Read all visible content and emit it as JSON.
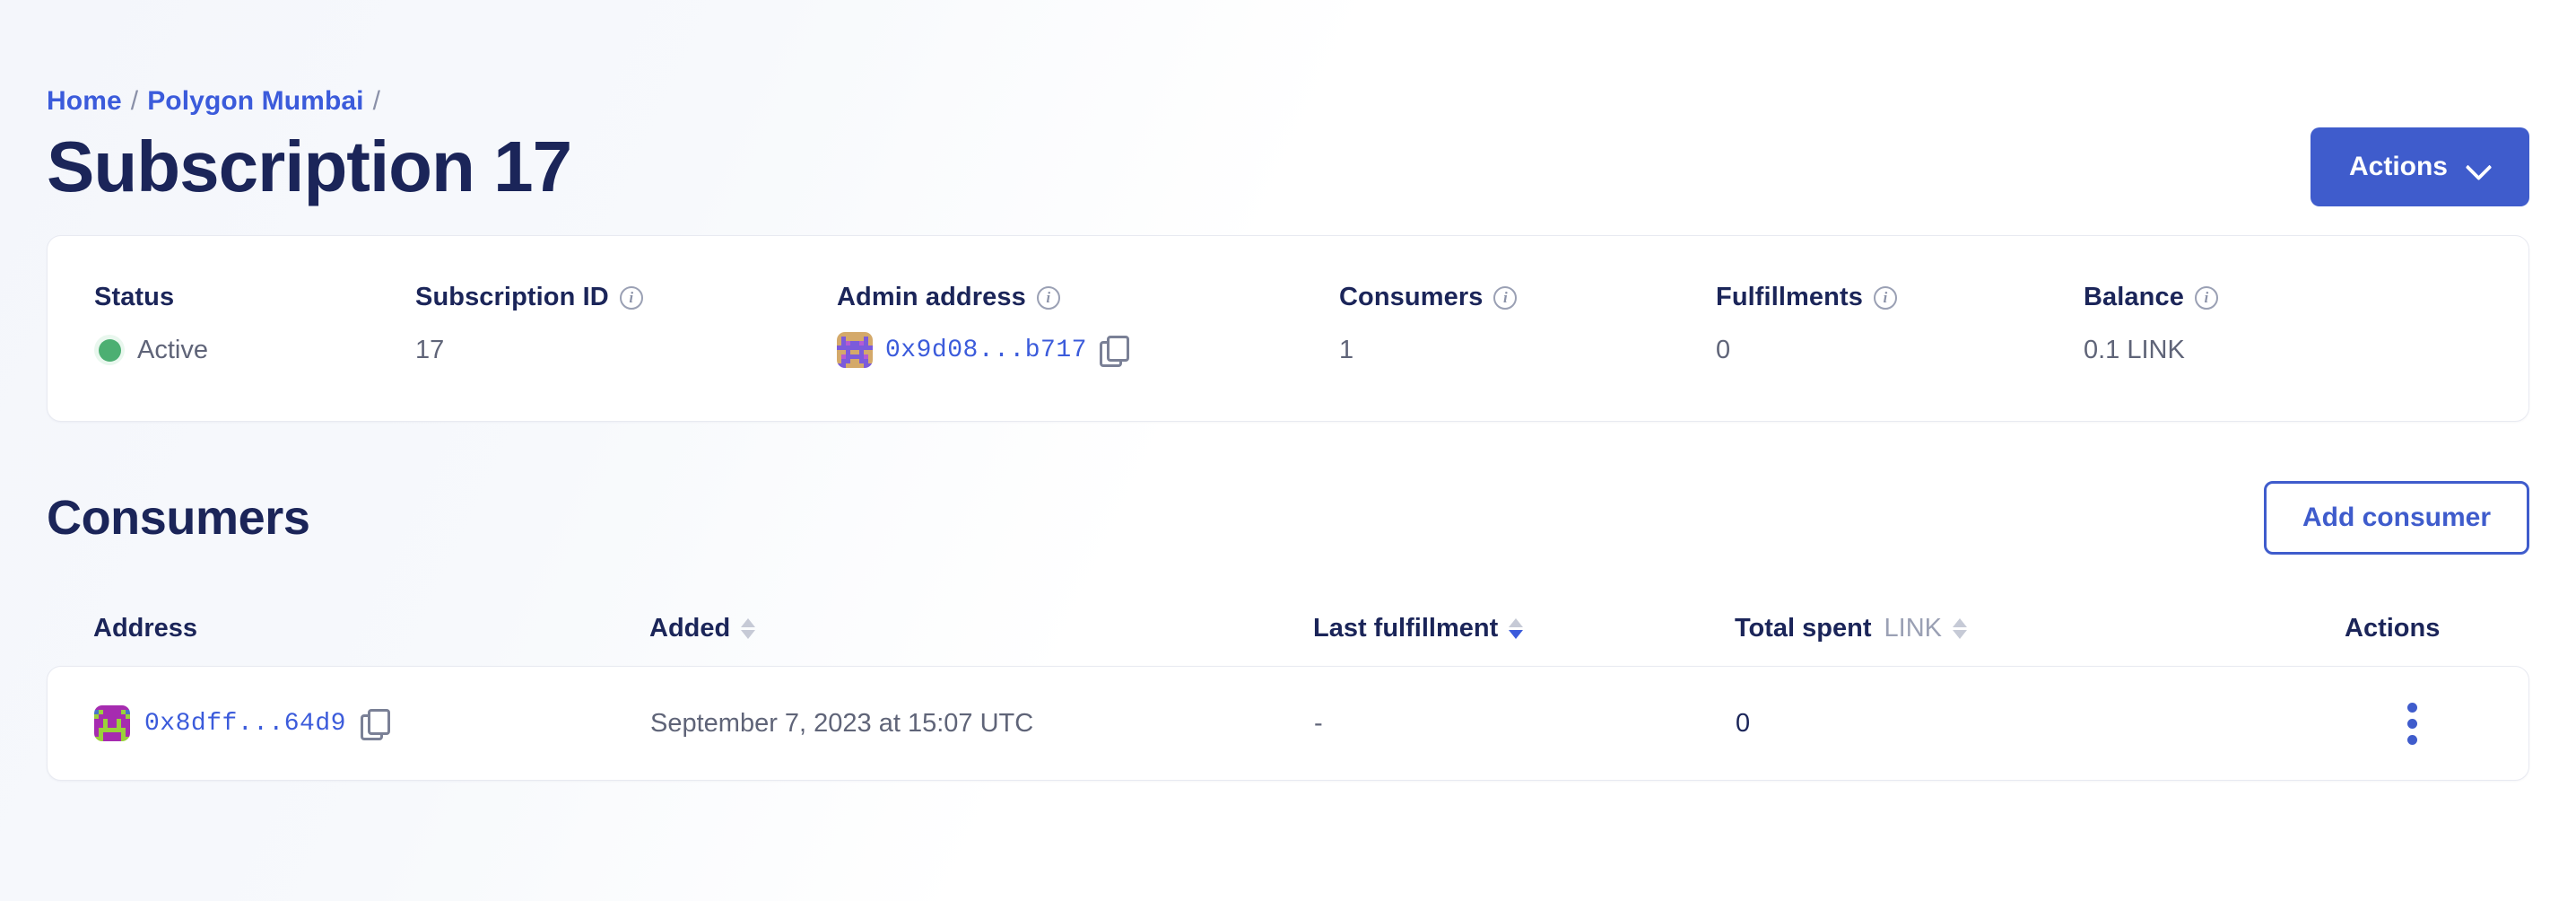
{
  "breadcrumb": {
    "items": [
      {
        "label": "Home",
        "link": true
      },
      {
        "label": "Polygon Mumbai",
        "link": true
      }
    ],
    "separator": "/"
  },
  "header": {
    "title": "Subscription 17",
    "actions_button": "Actions",
    "chevron_icon": "chevron-down-icon"
  },
  "stats": [
    {
      "label": "Status",
      "value": "Active",
      "has_info": false,
      "kind": "status"
    },
    {
      "label": "Subscription ID",
      "value": "17",
      "has_info": true,
      "kind": "text"
    },
    {
      "label": "Admin address",
      "value": "0x9d08...b717",
      "has_info": true,
      "kind": "address"
    },
    {
      "label": "Consumers",
      "value": "1",
      "has_info": true,
      "kind": "text"
    },
    {
      "label": "Fulfillments",
      "value": "0",
      "has_info": true,
      "kind": "text"
    },
    {
      "label": "Balance",
      "value": "0.1 LINK",
      "has_info": true,
      "kind": "text"
    }
  ],
  "consumers_section": {
    "title": "Consumers",
    "add_button": "Add consumer"
  },
  "table": {
    "columns": [
      {
        "key": "address",
        "label": "Address",
        "sortable": false,
        "sorted": null,
        "unit": null
      },
      {
        "key": "added",
        "label": "Added",
        "sortable": true,
        "sorted": null,
        "unit": null
      },
      {
        "key": "lastfulfill",
        "label": "Last fulfillment",
        "sortable": true,
        "sorted": "desc",
        "unit": null
      },
      {
        "key": "totalspent",
        "label": "Total spent",
        "sortable": true,
        "sorted": null,
        "unit": "LINK"
      },
      {
        "key": "actions",
        "label": "Actions",
        "sortable": false,
        "sorted": null,
        "unit": null
      }
    ],
    "rows": [
      {
        "address": "0x8dff...64d9",
        "added": "September 7, 2023 at 15:07 UTC",
        "last_fulfillment": "-",
        "total_spent": "0",
        "actions_icon": "kebab-menu-icon"
      }
    ]
  },
  "icons": {
    "copy": "copy-icon",
    "info": "info-icon",
    "sort": "sort-arrows-icon"
  },
  "colors": {
    "primary": "#3f5ccc",
    "link": "#3b5bdb",
    "heading": "#1b2559",
    "muted": "#5f6478",
    "status_active": "#4caf72",
    "border": "#e8eaf1"
  },
  "avatars": {
    "admin": {
      "name": "admin-address-blockie",
      "palette": [
        "#d4a96a",
        "#7b5bdb",
        "#b45bd4"
      ],
      "grid": [
        0,
        0,
        0,
        0,
        0,
        0,
        0,
        0,
        0,
        1,
        0,
        0,
        0,
        0,
        1,
        0,
        0,
        1,
        2,
        1,
        1,
        2,
        1,
        0,
        1,
        1,
        1,
        1,
        1,
        1,
        1,
        1,
        0,
        0,
        1,
        0,
        0,
        1,
        0,
        0,
        0,
        2,
        1,
        1,
        1,
        1,
        2,
        0,
        0,
        1,
        1,
        0,
        0,
        1,
        1,
        0,
        1,
        1,
        0,
        0,
        0,
        0,
        1,
        1
      ]
    },
    "consumer": {
      "name": "consumer-address-blockie",
      "palette": [
        "#9ad13a",
        "#a62bb0",
        "#4a72c8"
      ],
      "grid": [
        1,
        1,
        1,
        1,
        1,
        1,
        1,
        1,
        2,
        0,
        1,
        1,
        1,
        1,
        0,
        2,
        0,
        1,
        1,
        1,
        1,
        1,
        1,
        0,
        1,
        1,
        0,
        1,
        1,
        0,
        1,
        1,
        1,
        1,
        0,
        1,
        1,
        0,
        1,
        1,
        1,
        0,
        0,
        0,
        0,
        0,
        0,
        1,
        1,
        0,
        1,
        1,
        1,
        1,
        0,
        1,
        0,
        0,
        1,
        1,
        1,
        1,
        0,
        0
      ]
    }
  }
}
